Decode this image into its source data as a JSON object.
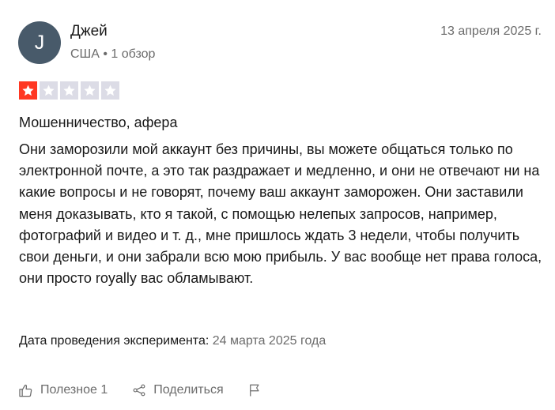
{
  "review": {
    "author": {
      "initial": "J",
      "name": "Джей",
      "meta": "США • 1 обзор"
    },
    "date": "13 апреля 2025 г.",
    "rating": 1,
    "rating_max": 5,
    "title": "Мошенничество, афера",
    "body": "Они заморозили мой аккаунт без причины, вы можете общаться только по электронной почте, а это так раздражает и медленно, и они не отвечают ни на какие вопросы и не говорят, почему ваш аккаунт заморожен. Они заставили меня доказывать, кто я такой, с помощью нелепых запросов, например, фотографий и видео и т. д., мне пришлось ждать 3 недели, чтобы получить свои деньги, и они забрали всю мою прибыль. У вас вообще нет права голоса, они просто royally вас обламывают.",
    "experience": {
      "label": "Дата проведения эксперимента:",
      "value": "24 марта 2025 года"
    }
  },
  "actions": {
    "useful_label": "Полезное 1",
    "share_label": "Поделиться"
  },
  "colors": {
    "star_filled": "#ff3722",
    "star_empty": "#dcdce6",
    "avatar_bg": "#485a6a",
    "muted_text": "#6b6b6b"
  },
  "icons": [
    "thumbs-up-icon",
    "share-icon",
    "flag-icon",
    "star-icon"
  ]
}
